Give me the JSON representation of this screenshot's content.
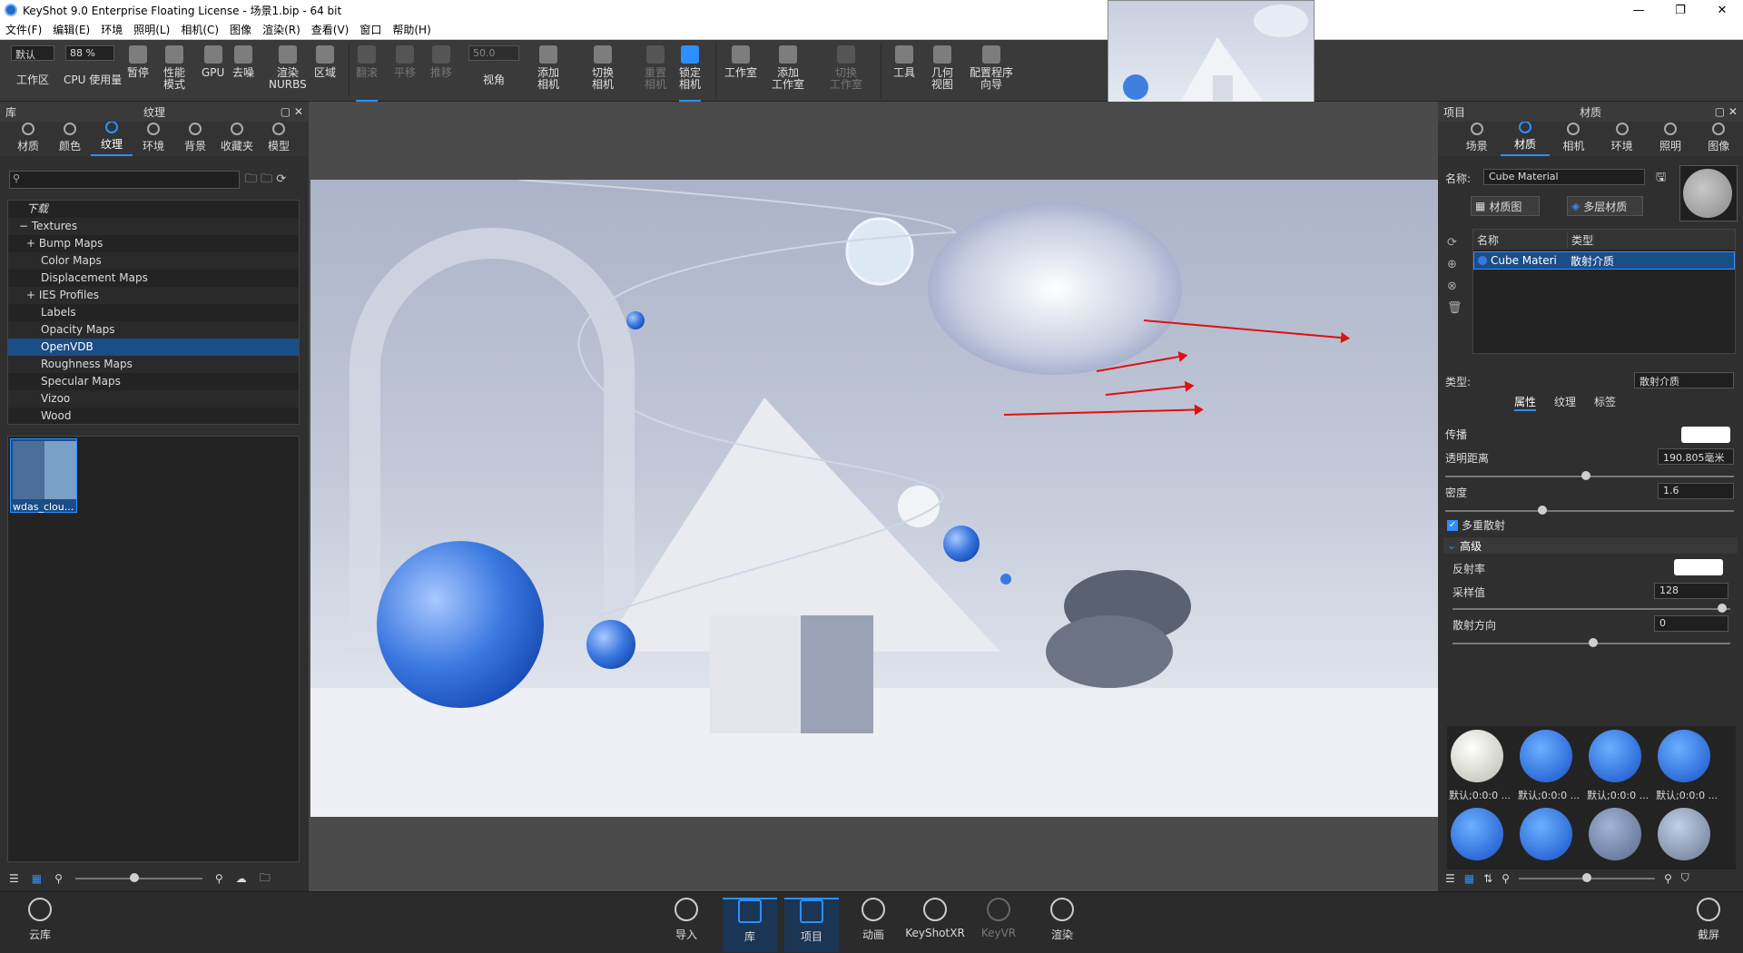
{
  "window": {
    "title": "KeyShot 9.0 Enterprise Floating License  - 场景1.bip  - 64 bit",
    "min": "—",
    "max": "❐",
    "close": "✕"
  },
  "menu": [
    "文件(F)",
    "编辑(E)",
    "环境",
    "照明(L)",
    "相机(C)",
    "图像",
    "渲染(R)",
    "查看(V)",
    "窗口",
    "帮助(H)"
  ],
  "toolbar": {
    "preset": "默认",
    "zoom": "88 %",
    "fov": "50.0",
    "items": [
      {
        "label": "工作区"
      },
      {
        "label": "CPU 使用量"
      },
      {
        "label": "暂停"
      },
      {
        "label": "性能\n模式"
      },
      {
        "label": "GPU"
      },
      {
        "label": "去噪"
      },
      {
        "label": "渲染\nNURBS"
      },
      {
        "label": "区域"
      },
      {
        "label": "翻滚"
      },
      {
        "label": "平移"
      },
      {
        "label": "推移"
      },
      {
        "label": "视角"
      },
      {
        "label": "添加\n相机"
      },
      {
        "label": "切换\n相机"
      },
      {
        "label": "重置\n相机"
      },
      {
        "label": "锁定\n相机"
      },
      {
        "label": "工作室"
      },
      {
        "label": "添加\n工作室"
      },
      {
        "label": "切换\n工作室"
      },
      {
        "label": "工具"
      },
      {
        "label": "几何\n视图"
      },
      {
        "label": "配置程序\n向导"
      }
    ]
  },
  "library": {
    "head_left": "库",
    "head_center": "纹理",
    "tabs": [
      "材质",
      "颜色",
      "纹理",
      "环境",
      "背景",
      "收藏夹",
      "模型"
    ],
    "tree": [
      {
        "label": "下载",
        "kind": "dl"
      },
      {
        "label": "Textures",
        "kind": "top",
        "mark": "−"
      },
      {
        "label": "Bump Maps",
        "mark": "+"
      },
      {
        "label": "Color Maps"
      },
      {
        "label": "Displacement Maps"
      },
      {
        "label": "IES Profiles",
        "mark": "+"
      },
      {
        "label": "Labels"
      },
      {
        "label": "Opacity Maps"
      },
      {
        "label": "OpenVDB",
        "selected": true
      },
      {
        "label": "Roughness Maps"
      },
      {
        "label": "Specular Maps"
      },
      {
        "label": "Vizoo"
      },
      {
        "label": "Wood"
      }
    ],
    "thumb_caption": "wdas_clou..."
  },
  "project": {
    "head_left": "项目",
    "head_center": "材质",
    "tabs": [
      "场景",
      "材质",
      "相机",
      "环境",
      "照明",
      "图像"
    ],
    "name_label": "名称:",
    "name_value": "Cube Material",
    "btn_matgraph": "材质图",
    "btn_multilayer": "多层材质",
    "list_cols": [
      "名称",
      "类型"
    ],
    "list_row": {
      "name": "Cube Materi",
      "type": "散射介质"
    },
    "type_label": "类型:",
    "type_value": "散射介质",
    "subtabs": [
      "属性",
      "纹理",
      "标签"
    ],
    "props": {
      "transmission": "传播",
      "clear_distance": "透明距离",
      "clear_distance_value": "190.805毫米",
      "density": "密度",
      "density_value": "1.6",
      "multi_scatter": "多重散射",
      "advanced": "高级",
      "albedo": "反射率",
      "samples": "采样值",
      "samples_value": "128",
      "scatter_dir": "散射方向",
      "scatter_dir_value": "0"
    },
    "ball_caption": "默认;0:0:0 ..."
  },
  "bottom": [
    "云库",
    "导入",
    "库",
    "项目",
    "动画",
    "KeyShotXR",
    "KeyVR",
    "渲染",
    "截屏"
  ],
  "colors": {
    "accent": "#2d8fff",
    "selected": "#1b4d86",
    "arrow": "#e01010"
  }
}
